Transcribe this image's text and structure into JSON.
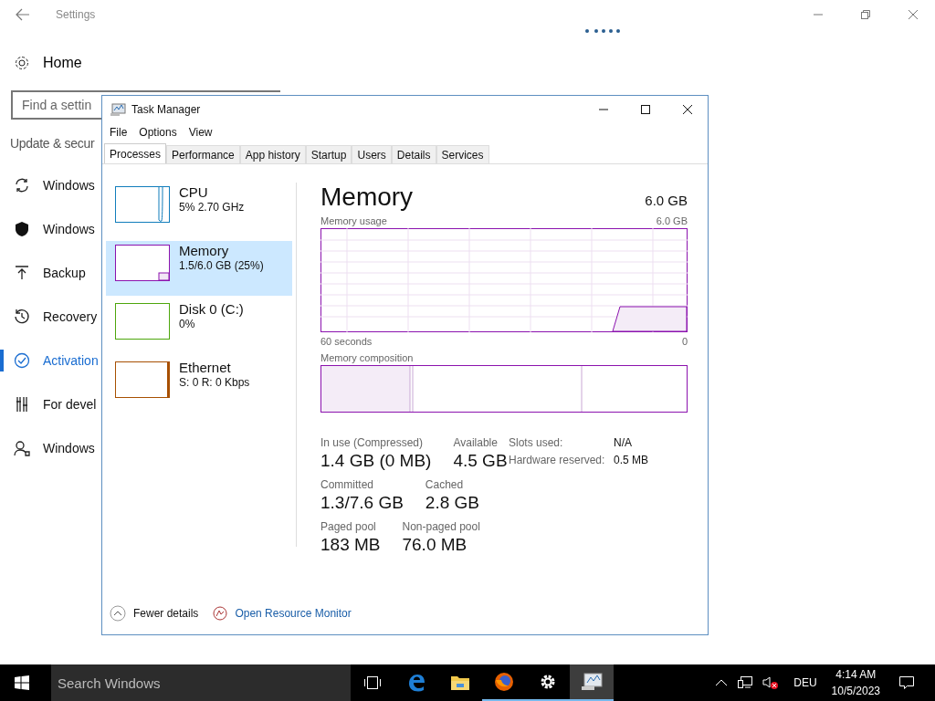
{
  "settings": {
    "title": "Settings",
    "home": "Home",
    "search": {
      "placeholder": "Find a settin"
    },
    "section": "Update & secur",
    "nav": [
      {
        "kind": "sync",
        "label": "Windows",
        "selected": false
      },
      {
        "kind": "shield",
        "label": "Windows",
        "selected": false
      },
      {
        "kind": "backup",
        "label": "Backup",
        "selected": false
      },
      {
        "kind": "recovery",
        "label": "Recovery",
        "selected": false
      },
      {
        "kind": "activation",
        "label": "Activation",
        "selected": true
      },
      {
        "kind": "developer",
        "label": "For devel",
        "selected": false
      },
      {
        "kind": "insider",
        "label": "Windows",
        "selected": false
      }
    ]
  },
  "task_manager": {
    "title": "Task Manager",
    "menu": [
      "File",
      "Options",
      "View"
    ],
    "tabs": [
      {
        "label": "Processes",
        "selected": true
      },
      {
        "label": "Performance",
        "selected": false
      },
      {
        "label": "App history",
        "selected": false
      },
      {
        "label": "Startup",
        "selected": false
      },
      {
        "label": "Users",
        "selected": false
      },
      {
        "label": "Details",
        "selected": false
      },
      {
        "label": "Services",
        "selected": false
      }
    ],
    "resources": [
      {
        "kind": "cpu",
        "name": "CPU",
        "detail": "5% 2.70 GHz",
        "color": "#117dbb",
        "selected": false
      },
      {
        "kind": "memory",
        "name": "Memory",
        "detail": "1.5/6.0 GB (25%)",
        "color": "#8b12ae",
        "selected": true
      },
      {
        "kind": "disk",
        "name": "Disk 0 (C:)",
        "detail": "0%",
        "color": "#4da60c",
        "selected": false
      },
      {
        "kind": "ethernet",
        "name": "Ethernet",
        "detail": "S: 0 R: 0 Kbps",
        "color": "#a74f01",
        "selected": false
      }
    ],
    "detail": {
      "title": "Memory",
      "capacity": "6.0 GB",
      "usage_label": "Memory usage",
      "usage_max": "6.0 GB",
      "time_label": "60 seconds",
      "time_end": "0",
      "composition_label": "Memory composition",
      "stat_rows": [
        {
          "items": [
            {
              "label": "In use (Compressed)",
              "value": "1.4 GB (0 MB)"
            },
            {
              "label": "Available",
              "value": "4.5 GB"
            }
          ]
        },
        {
          "items": [
            {
              "label": "Committed",
              "value": "1.3/7.6 GB"
            },
            {
              "label": "Cached",
              "value": "2.8 GB"
            }
          ]
        },
        {
          "items": [
            {
              "label": "Paged pool",
              "value": "183 MB"
            },
            {
              "label": "Non-paged pool",
              "value": "76.0 MB"
            }
          ]
        }
      ],
      "hardware": [
        {
          "label": "Slots used:",
          "value": "N/A"
        },
        {
          "label": "Hardware reserved:",
          "value": "0.5 MB"
        }
      ]
    },
    "footer": {
      "fewer": "Fewer details",
      "monitor": "Open Resource Monitor"
    }
  },
  "taskbar": {
    "search": {
      "placeholder": "Search Windows"
    },
    "apps": [
      {
        "kind": "taskview",
        "running": false,
        "selected": false
      },
      {
        "kind": "edge",
        "running": false,
        "selected": false
      },
      {
        "kind": "explorer",
        "running": false,
        "selected": false
      },
      {
        "kind": "firefox",
        "running": true,
        "selected": false
      },
      {
        "kind": "settings",
        "running": true,
        "selected": false
      },
      {
        "kind": "taskmanager",
        "running": true,
        "selected": true
      }
    ],
    "tray": {
      "language": "DEU",
      "time": "4:14 AM",
      "date": "10/5/2023"
    }
  }
}
